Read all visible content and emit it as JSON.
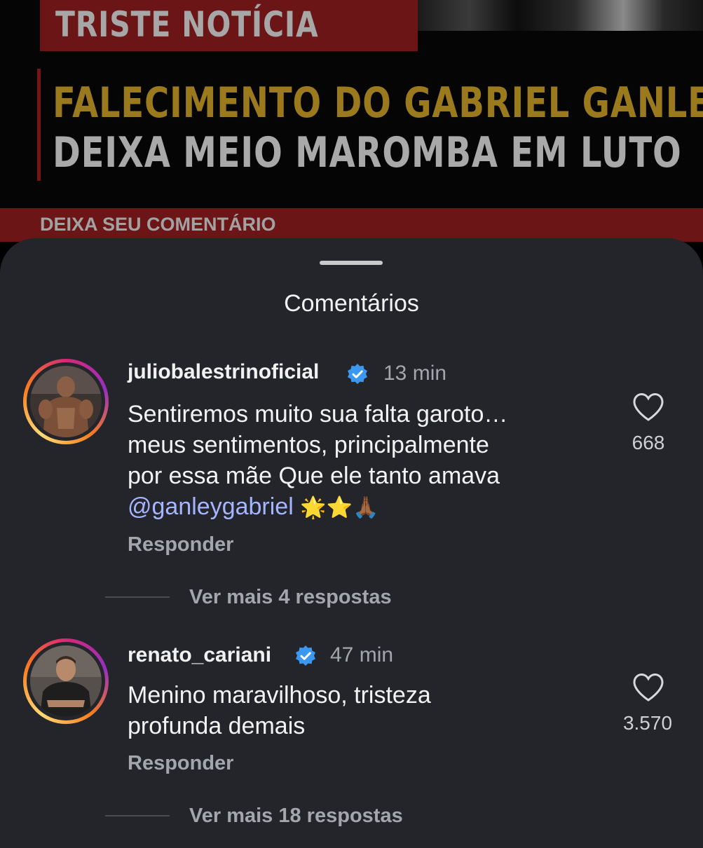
{
  "post": {
    "banner": "TRISTE NOTÍCIA",
    "headline_line1": "FALECIMENTO DO GABRIEL GANLEY",
    "headline_line2": "DEIXA MEIO MAROMBA EM LUTO",
    "cta": "DEIXA SEU COMENTÁRIO"
  },
  "sheet": {
    "title": "Comentários"
  },
  "comments": [
    {
      "username": "juliobalestrinoficial",
      "verified": true,
      "time": "13 min",
      "text_line1": "Sentiremos muito sua falta garoto…",
      "text_line2": "meus sentimentos, principalmente",
      "text_line3": "por essa mãe  Que ele tanto amava",
      "mention": "@ganleygabriel",
      "emojis": "🌟⭐🙏🏾",
      "likes": "668",
      "reply_label": "Responder",
      "more_replies": "Ver mais 4 respostas"
    },
    {
      "username": "renato_cariani",
      "verified": true,
      "time": "47 min",
      "text_line1": "Menino maravilhoso, tristeza",
      "text_line2": "profunda demais",
      "likes": "3.570",
      "reply_label": "Responder",
      "more_replies": "Ver mais 18 respostas"
    }
  ],
  "colors": {
    "sheet_bg": "#23252b",
    "accent_red": "#6b1516",
    "headline_gold": "#9a7a1d",
    "mention": "#a6b5ff",
    "verified": "#3b97f0"
  }
}
